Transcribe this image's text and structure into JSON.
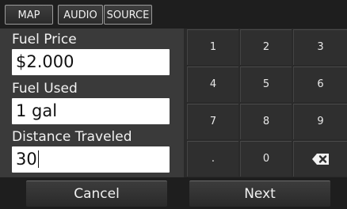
{
  "tabs": [
    {
      "label": "MAP"
    },
    {
      "label": "AUDIO"
    },
    {
      "label": "SOURCE"
    }
  ],
  "form": {
    "fuel_price": {
      "label": "Fuel Price",
      "value": "$2.000"
    },
    "fuel_used": {
      "label": "Fuel Used",
      "value": "1 gal"
    },
    "distance": {
      "label": "Distance Traveled",
      "value": "30"
    }
  },
  "keypad": {
    "keys": [
      "1",
      "2",
      "3",
      "4",
      "5",
      "6",
      "7",
      "8",
      "9",
      ".",
      "0"
    ],
    "backspace_icon": "backspace-icon"
  },
  "buttons": {
    "cancel": "Cancel",
    "next": "Next"
  }
}
